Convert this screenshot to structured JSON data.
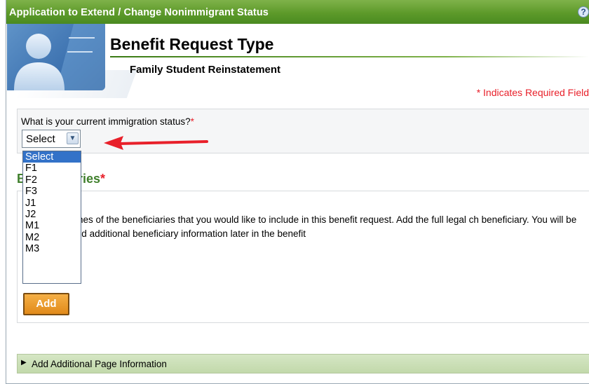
{
  "window": {
    "title": "Application to Extend / Change Nonimmigrant Status",
    "help_icon": "help-question-icon",
    "help_glyph": "?"
  },
  "header": {
    "page_title": "Benefit Request Type",
    "subtitle": "Family Student Reinstatement",
    "required_note": "* Indicates Required Field"
  },
  "status": {
    "question": "What is your current immigration status?",
    "required_mark": "*",
    "selected": "Select",
    "options": [
      "Select",
      "F1",
      "F2",
      "F3",
      "J1",
      "J2",
      "M1",
      "M2",
      "M3"
    ]
  },
  "beneficiaries": {
    "heading_visible": "B",
    "heading_tail": "ries",
    "required_mark": "*",
    "instructions": "nes of the beneficiaries that you would like to include in this benefit request. Add the full legal ch beneficiary. You will be required to add additional beneficiary information later in the benefit",
    "add_label": "Add"
  },
  "footer": {
    "expander_label": "Add Additional Page Information",
    "expander_icon": "triangle-right-icon"
  },
  "colors": {
    "titlebar_green": "#5d9a2a",
    "heading_green": "#3f7f2b",
    "required_red": "#e8202a",
    "add_orange": "#e18a1a",
    "select_highlight": "#3372c8",
    "annotation_arrow": "#e8202a"
  }
}
